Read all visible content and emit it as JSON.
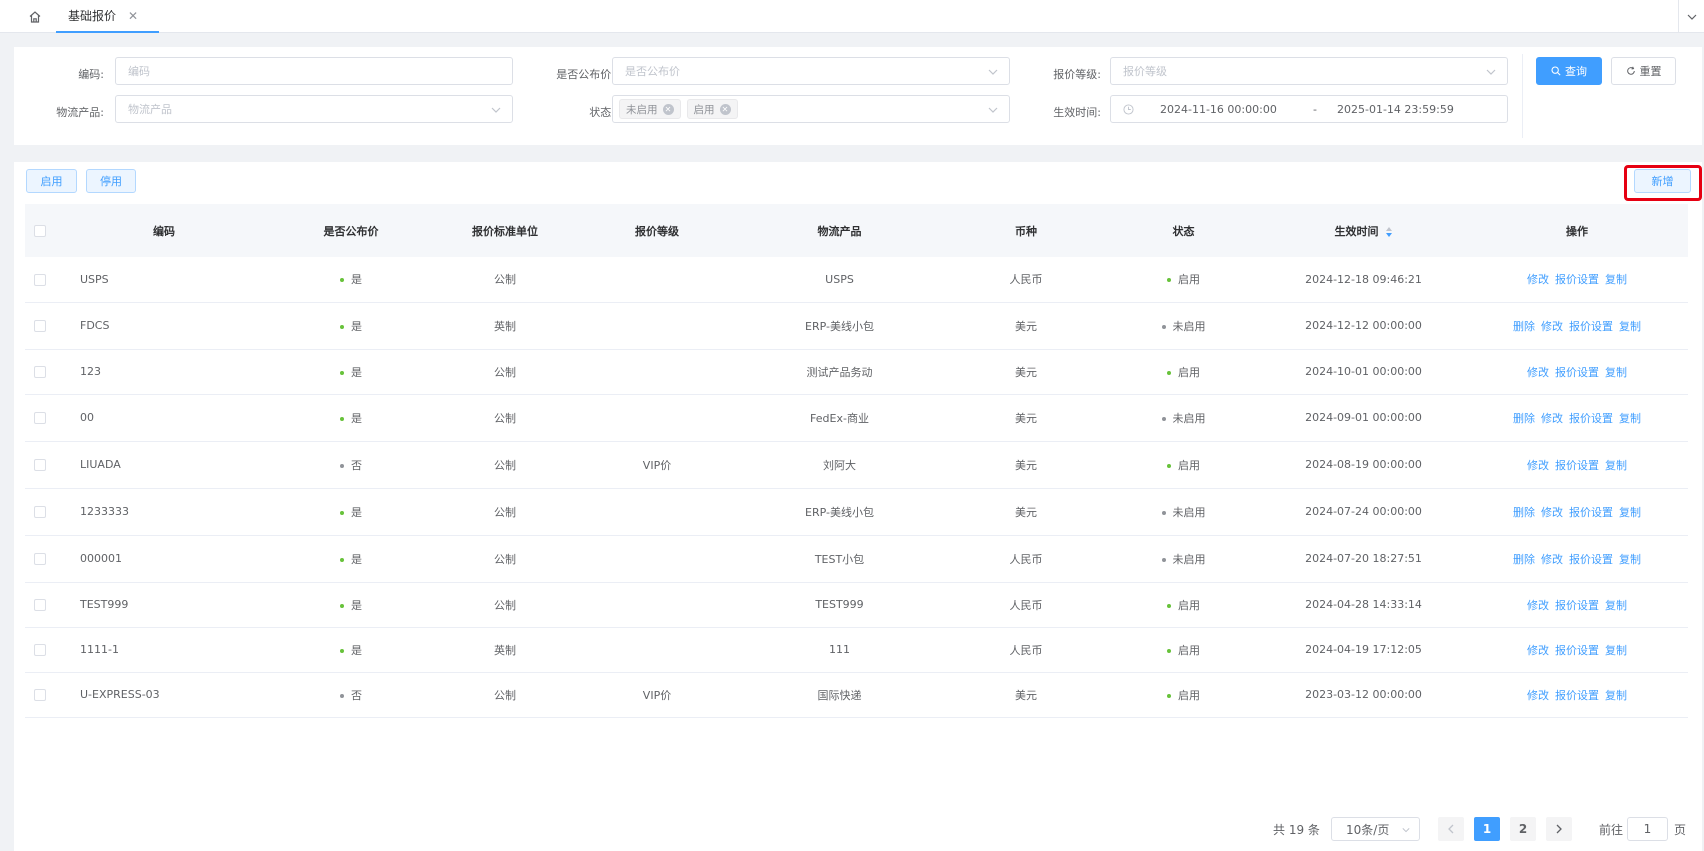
{
  "tabs": {
    "home_icon": "home-icon",
    "active_tab": "基础报价",
    "close_glyph": "✕"
  },
  "filters": {
    "code": {
      "label": "编码:",
      "placeholder": "编码"
    },
    "is_public": {
      "label": "是否公布价:",
      "placeholder": "是否公布价"
    },
    "grade": {
      "label": "报价等级:",
      "placeholder": "报价等级"
    },
    "product": {
      "label": "物流产品:",
      "placeholder": "物流产品"
    },
    "status": {
      "label": "状态:",
      "tags": [
        "未启用",
        "启用"
      ]
    },
    "effective": {
      "label": "生效时间:",
      "start": "2024-11-16 00:00:00",
      "separator": "-",
      "end": "2025-01-14 23:59:59"
    },
    "search_label": "查询",
    "reset_label": "重置"
  },
  "toolbar": {
    "enable_label": "启用",
    "disable_label": "停用",
    "add_label": "新增"
  },
  "table": {
    "headers": [
      "编码",
      "是否公布价",
      "报价标准单位",
      "报价等级",
      "物流产品",
      "币种",
      "状态",
      "生效时间",
      "操作"
    ],
    "rows": [
      {
        "code": "USPS",
        "public": "是",
        "unit": "公制",
        "grade": "",
        "product": "USPS",
        "currency": "人民币",
        "status": "启用",
        "time": "2024-12-18 09:46:21",
        "ops": [
          "修改",
          "报价设置",
          "复制"
        ]
      },
      {
        "code": "FDCS",
        "public": "是",
        "unit": "英制",
        "grade": "",
        "product": "ERP-美线小包",
        "currency": "美元",
        "status": "未启用",
        "time": "2024-12-12 00:00:00",
        "ops": [
          "删除",
          "修改",
          "报价设置",
          "复制"
        ]
      },
      {
        "code": "123",
        "public": "是",
        "unit": "公制",
        "grade": "",
        "product": "测试产品务动",
        "currency": "美元",
        "status": "启用",
        "time": "2024-10-01 00:00:00",
        "ops": [
          "修改",
          "报价设置",
          "复制"
        ]
      },
      {
        "code": "00",
        "public": "是",
        "unit": "公制",
        "grade": "",
        "product": "FedEx-商业",
        "currency": "美元",
        "status": "未启用",
        "time": "2024-09-01 00:00:00",
        "ops": [
          "删除",
          "修改",
          "报价设置",
          "复制"
        ]
      },
      {
        "code": "LIUADA",
        "public": "否",
        "unit": "公制",
        "grade": "VIP价",
        "product": "刘阿大",
        "currency": "美元",
        "status": "启用",
        "time": "2024-08-19 00:00:00",
        "ops": [
          "修改",
          "报价设置",
          "复制"
        ]
      },
      {
        "code": "1233333",
        "public": "是",
        "unit": "公制",
        "grade": "",
        "product": "ERP-美线小包",
        "currency": "美元",
        "status": "未启用",
        "time": "2024-07-24 00:00:00",
        "ops": [
          "删除",
          "修改",
          "报价设置",
          "复制"
        ]
      },
      {
        "code": "000001",
        "public": "是",
        "unit": "公制",
        "grade": "",
        "product": "TEST小包",
        "currency": "人民币",
        "status": "未启用",
        "time": "2024-07-20 18:27:51",
        "ops": [
          "删除",
          "修改",
          "报价设置",
          "复制"
        ]
      },
      {
        "code": "TEST999",
        "public": "是",
        "unit": "公制",
        "grade": "",
        "product": "TEST999",
        "currency": "人民币",
        "status": "启用",
        "time": "2024-04-28 14:33:14",
        "ops": [
          "修改",
          "报价设置",
          "复制"
        ]
      },
      {
        "code": "1111-1",
        "public": "是",
        "unit": "英制",
        "grade": "",
        "product": "111",
        "currency": "人民币",
        "status": "启用",
        "time": "2024-04-19 17:12:05",
        "ops": [
          "修改",
          "报价设置",
          "复制"
        ]
      },
      {
        "code": "U-EXPRESS-03",
        "public": "否",
        "unit": "公制",
        "grade": "VIP价",
        "product": "国际快递",
        "currency": "美元",
        "status": "启用",
        "time": "2023-03-12 00:00:00",
        "ops": [
          "修改",
          "报价设置",
          "复制"
        ]
      }
    ]
  },
  "pagination": {
    "total": "共 19 条",
    "page_size": "10条/页",
    "pages": [
      "1",
      "2"
    ],
    "current_page": "1",
    "goto_prefix": "前往",
    "goto_value": "1",
    "goto_suffix": "页"
  },
  "colors": {
    "primary": "#409eff",
    "enabled_dot": "#67c23a",
    "disabled_dot": "#909399",
    "highlight_box": "#e60012"
  }
}
